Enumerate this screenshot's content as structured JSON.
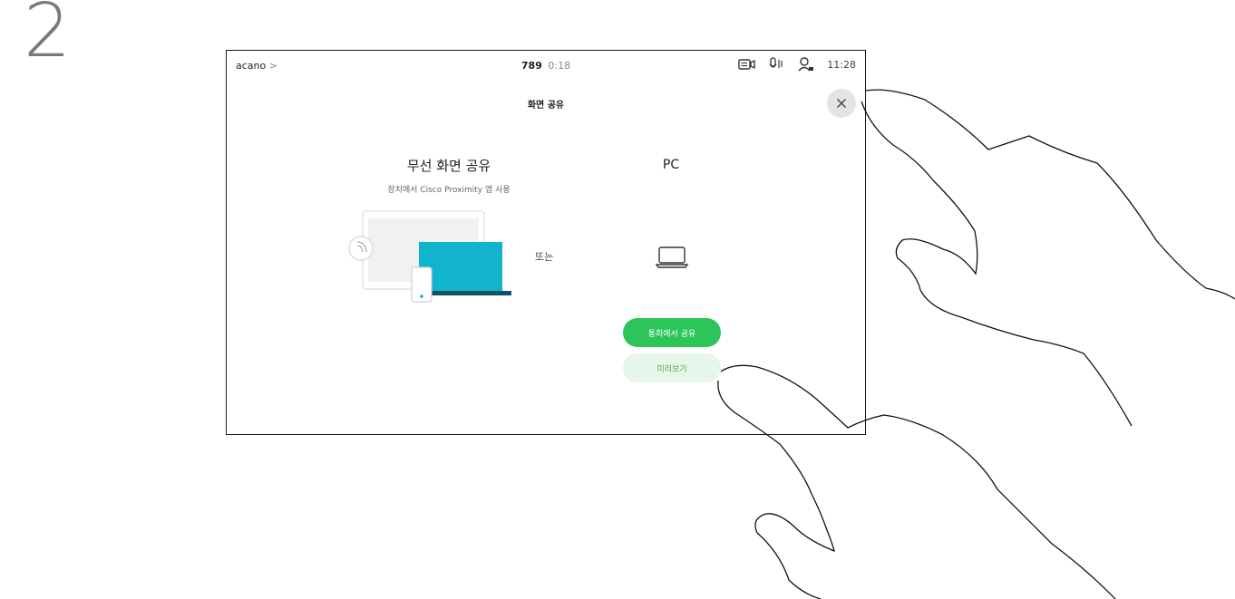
{
  "step": {
    "number": "2"
  },
  "status_bar": {
    "site_name": "acano",
    "site_chevron": ">",
    "call_number": "789",
    "call_timer": "0:18",
    "clock": "11:28",
    "icons": [
      "camera-icon",
      "microphone-icon",
      "participants-icon"
    ]
  },
  "screen": {
    "title": "화면 공유",
    "close_icon": "close-icon"
  },
  "wireless": {
    "title": "무선 화면 공유",
    "subtitle": "장치에서 Cisco Proximity 앱 사용"
  },
  "or_label": "또는",
  "pc": {
    "title": "PC",
    "icon": "laptop-icon"
  },
  "buttons": {
    "share_in_call": "통화에서 공유",
    "preview": "미리보기"
  },
  "colors": {
    "accent_green": "#2bc55a",
    "preview_bg": "#e6f7ea",
    "illustration_teal": "#12b3cc"
  }
}
